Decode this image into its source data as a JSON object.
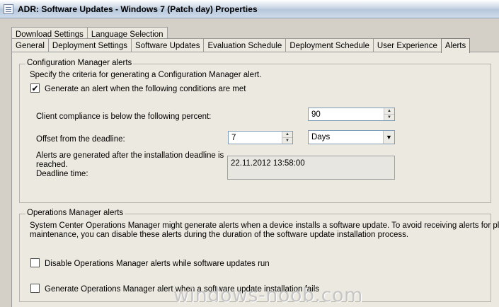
{
  "window": {
    "title": "ADR:  Software Updates - Windows 7 (Patch day) Properties"
  },
  "tabs": {
    "row1": [
      "Download Settings",
      "Language Selection"
    ],
    "row2": [
      "General",
      "Deployment Settings",
      "Software Updates",
      "Evaluation Schedule",
      "Deployment Schedule",
      "User Experience",
      "Alerts"
    ],
    "active": "Alerts"
  },
  "config_alerts": {
    "group_label": "Configuration Manager alerts",
    "description": "Specify the criteria for generating a Configuration Manager alert.",
    "generate_checkbox": {
      "label": "Generate an alert when the following conditions are met",
      "checked": true,
      "mark": "✔"
    },
    "compliance": {
      "label": "Client compliance is below the  following percent:",
      "value": "90"
    },
    "offset": {
      "label": "Offset from the deadline:",
      "value": "7",
      "unit": "Days"
    },
    "deadline_note_line1": "Alerts are generated after the installation deadline is",
    "deadline_note_line2": "reached.",
    "deadline_label": "Deadline time:",
    "deadline_value": "22.11.2012 13:58:00"
  },
  "ops_alerts": {
    "group_label": "Operations Manager alerts",
    "description_line1": "System Center Operations Manager might generate alerts when a device installs a software update. To avoid receiving alerts for planned",
    "description_line2": "maintenance, you can disable these alerts during the duration of the software update installation process.",
    "disable_checkbox": {
      "label": "Disable Operations Manager alerts while software updates run",
      "checked": false
    },
    "generate_checkbox": {
      "label": "Generate Operations Manager alert when a software update installation fails",
      "checked": false
    }
  },
  "watermark": "windows-noob.com",
  "icons": {
    "window": "window-icon",
    "spin_up": "▲",
    "spin_down": "▼",
    "dropdown": "▼"
  }
}
